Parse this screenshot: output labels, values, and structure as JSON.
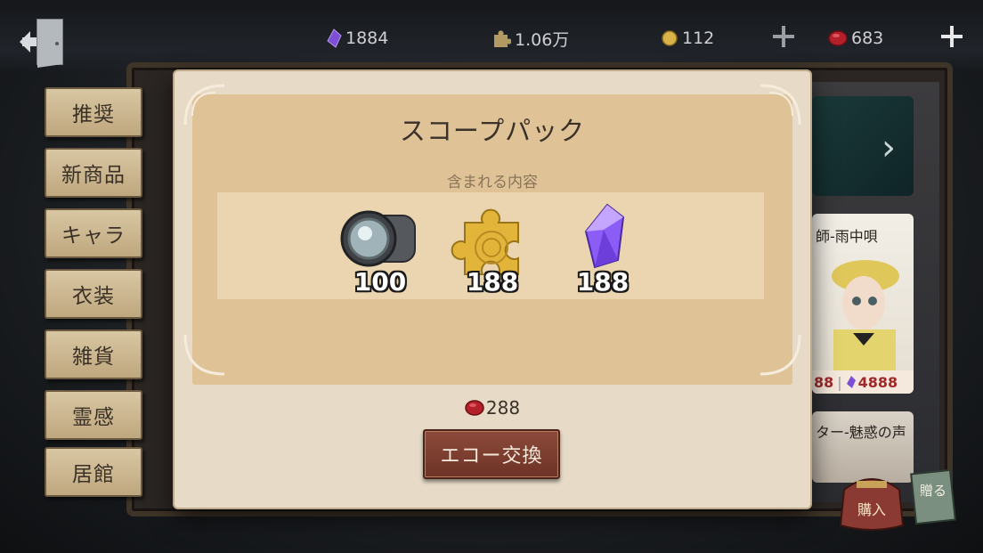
{
  "currencies": {
    "crystal": "1884",
    "clue": "1.06万",
    "echo_coin": "112",
    "echo": "683"
  },
  "tabs": [
    "推奨",
    "新商品",
    "キャラ",
    "衣装",
    "雑貨",
    "霊感",
    "居館"
  ],
  "shop": {
    "featured_name": "師-雨中唄",
    "featured_price_left": "88",
    "featured_price_right": "4888",
    "second_name": "ター-魅惑の声",
    "buy_label": "購入",
    "gift_label": "贈る"
  },
  "modal": {
    "title": "スコープパック",
    "subtitle": "含まれる内容",
    "items": [
      {
        "icon": "scope-lens-icon",
        "qty": "100"
      },
      {
        "icon": "golden-puzzle-clue-icon",
        "qty": "188"
      },
      {
        "icon": "purple-crystal-icon",
        "qty": "188"
      }
    ],
    "price": "288",
    "exchange_label": "エコー交換"
  },
  "colors": {
    "modal_bg": "#e7dbc7",
    "panel_bg": "#dfc296",
    "button": "#7a3b2d",
    "echo_red": "#b3202a",
    "crystal_purple": "#8b5cf6"
  }
}
